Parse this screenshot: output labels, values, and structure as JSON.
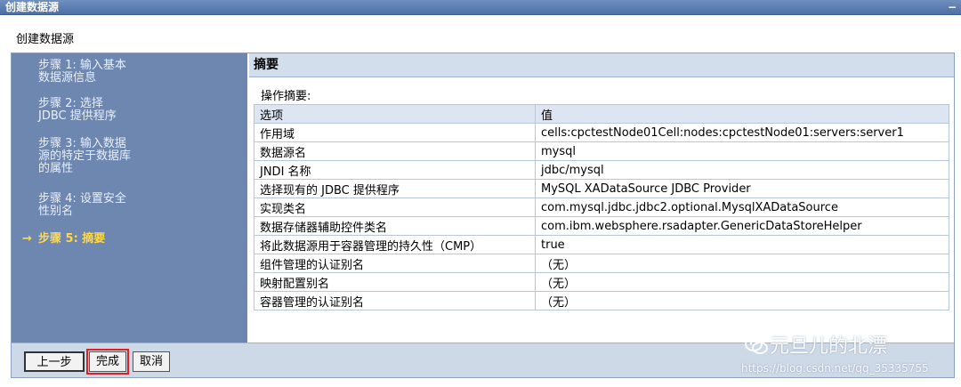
{
  "window": {
    "title": "创建数据源",
    "minimize_glyph": "−"
  },
  "wizard": {
    "heading": "创建数据源",
    "steps": [
      {
        "label_line1": "步骤 1: 输入基本",
        "label_line2": "数据源信息"
      },
      {
        "label_line1": "步骤 2: 选择",
        "label_line2": "JDBC 提供程序"
      },
      {
        "label_line1": "步骤 3: 输入数据",
        "label_line2": "源的特定于数据库",
        "label_line3": "的属性"
      },
      {
        "label_line1": "步骤 4: 设置安全",
        "label_line2": "性别名"
      },
      {
        "label": "步骤 5: 摘要",
        "current": true,
        "arrow": "→"
      }
    ]
  },
  "summary": {
    "header": "摘要",
    "ops_label": "操作摘要:",
    "columns": [
      "选项",
      "值"
    ],
    "rows": [
      [
        "作用域",
        "cells:cpctestNode01Cell:nodes:cpctestNode01:servers:server1"
      ],
      [
        "数据源名",
        "mysql"
      ],
      [
        "JNDI 名称",
        "jdbc/mysql"
      ],
      [
        "选择现有的 JDBC 提供程序",
        "MySQL XADataSource JDBC Provider"
      ],
      [
        "实现类名",
        "com.mysql.jdbc.jdbc2.optional.MysqlXADataSource"
      ],
      [
        "数据存储器辅助控件类名",
        "com.ibm.websphere.rsadapter.GenericDataStoreHelper"
      ],
      [
        "将此数据源用于容器管理的持久性（CMP）",
        "true"
      ],
      [
        "组件管理的认证别名",
        "（无）"
      ],
      [
        "映射配置别名",
        "（无）"
      ],
      [
        "容器管理的认证别名",
        "（无）"
      ]
    ]
  },
  "buttons": {
    "prev": "上一步",
    "finish": "完成",
    "cancel": "取消"
  },
  "watermark": {
    "text": "元旦儿的北漂",
    "url": "https://blog.csdn.net/qq_35335755",
    "icon": "wechat-icon"
  },
  "colors": {
    "sidebar": "#6d87b1",
    "current_step": "#ffd84a",
    "highlight": "#e02020"
  }
}
